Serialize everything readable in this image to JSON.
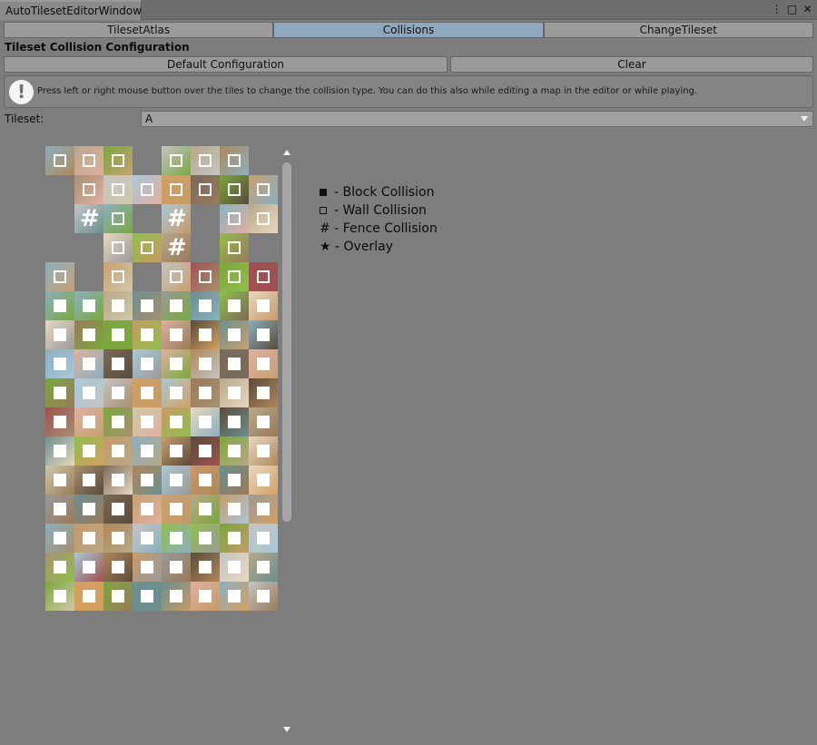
{
  "window": {
    "title": "AutoTilesetEditorWindow"
  },
  "tabs": [
    {
      "label": "TilesetAtlas",
      "active": false
    },
    {
      "label": "Collisions",
      "active": true
    },
    {
      "label": "ChangeTileset",
      "active": false
    }
  ],
  "section_title": "Tileset Collision Configuration",
  "buttons": {
    "default_config": "Default Configuration",
    "clear": "Clear"
  },
  "help": {
    "text": "Press left or right mouse button over the tiles to change the collision type. You can do this also while editing a map in the editor or while playing."
  },
  "tileset": {
    "label": "Tileset:",
    "selected": "A"
  },
  "legend": [
    {
      "symbol": "block",
      "label": "Block Collision"
    },
    {
      "symbol": "wall",
      "label": "Wall Collision"
    },
    {
      "symbol": "#",
      "label": "Fence Collision"
    },
    {
      "symbol": "★",
      "label": "Overlay"
    }
  ],
  "colors": {
    "accent_tab": "#8fa7bf",
    "background": "#7d7d7d"
  }
}
